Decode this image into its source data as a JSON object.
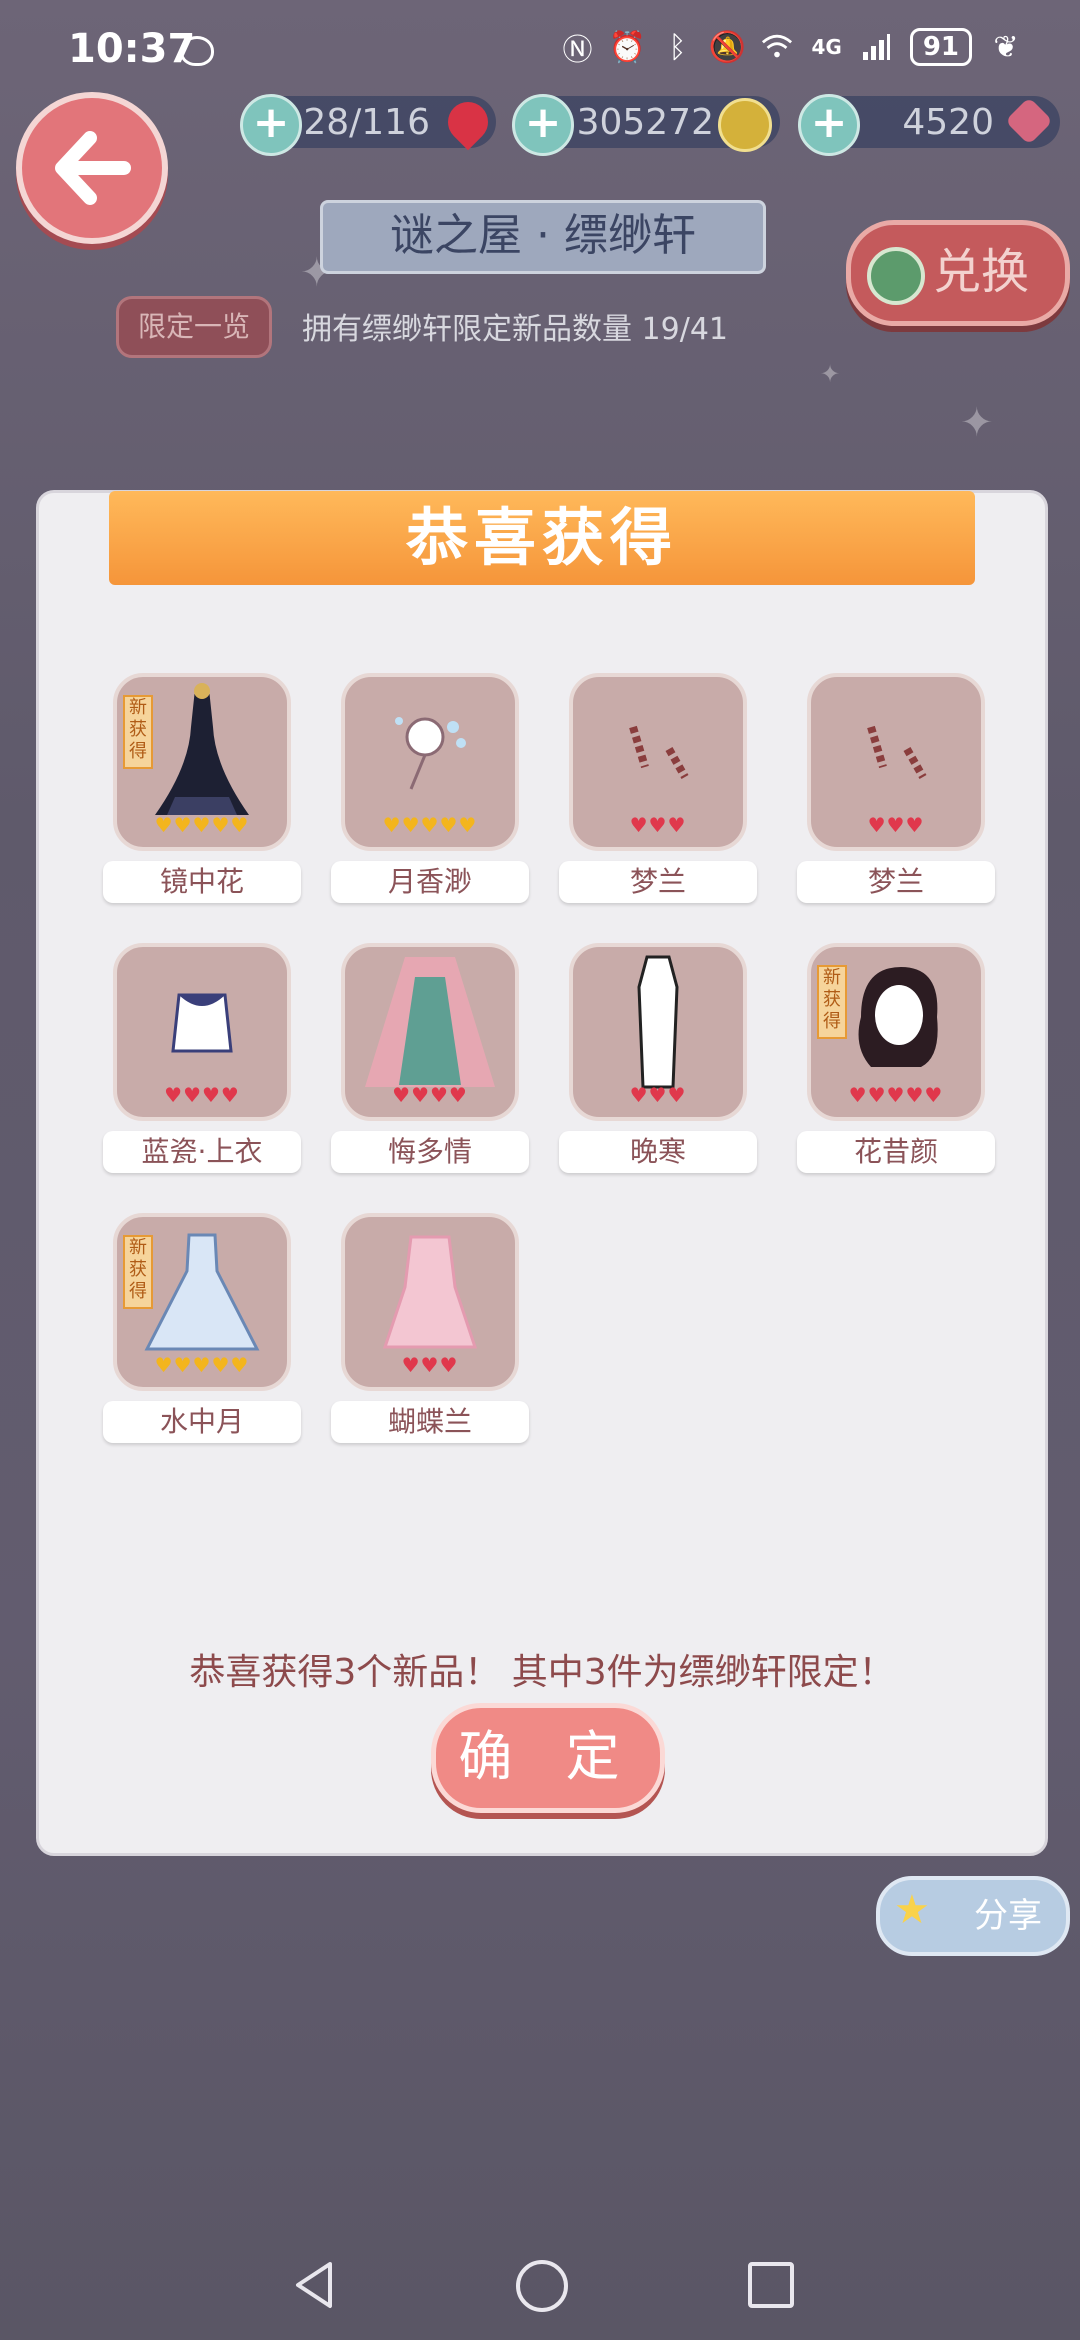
{
  "status_bar": {
    "time": "10:37",
    "network": "4G",
    "battery": "91"
  },
  "top_bar": {
    "stamina": "28/116",
    "coins": "305272",
    "diamonds": "4520",
    "title": "谜之屋 · 缥缈轩",
    "exchange_label": "兑换",
    "limited_list_label": "限定一览",
    "owned_text": "拥有缥缈轩限定新品数量 19/41"
  },
  "dialog": {
    "title": "恭喜获得",
    "new_tag": "新获得",
    "items": [
      {
        "name": "镜中花",
        "hearts": "♥♥♥♥♥"
      },
      {
        "name": "月香渺",
        "hearts": "♥♥♥♥♥"
      },
      {
        "name": "梦兰",
        "hearts": "♥♥♥"
      },
      {
        "name": "梦兰",
        "hearts": "♥♥♥"
      },
      {
        "name": "蓝瓷·上衣",
        "hearts": "♥♥♥♥"
      },
      {
        "name": "悔多情",
        "hearts": "♥♥♥♥"
      },
      {
        "name": "晚寒",
        "hearts": "♥♥♥"
      },
      {
        "name": "花昔颜",
        "hearts": "♥♥♥♥♥"
      },
      {
        "name": "水中月",
        "hearts": "♥♥♥♥♥"
      },
      {
        "name": "蝴蝶兰",
        "hearts": "♥♥♥"
      }
    ],
    "message": "恭喜获得3个新品！ 其中3件为缥缈轩限定！",
    "confirm_label": "确 定"
  },
  "share_label": "分享",
  "colors": {
    "accent": "#f08a86",
    "banner": "#f5953a",
    "tile": "#c8aba9"
  }
}
